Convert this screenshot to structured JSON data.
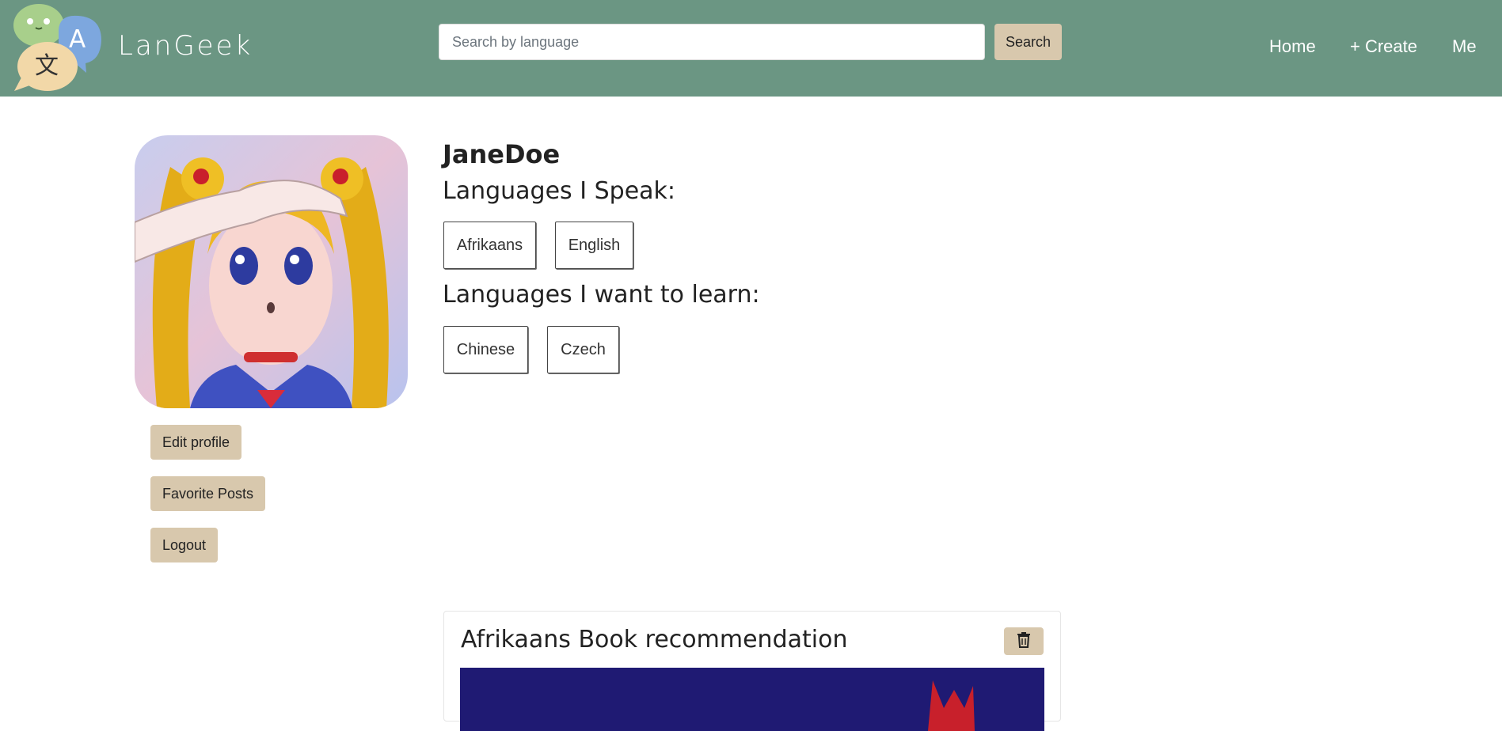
{
  "brand": {
    "name": "LanGeek"
  },
  "search": {
    "placeholder": "Search by language",
    "button_label": "Search"
  },
  "nav": {
    "home": "Home",
    "create": "+ Create",
    "me": "Me"
  },
  "profile": {
    "username": "JaneDoe",
    "speak_heading": "Languages I Speak:",
    "speak_languages": [
      "Afrikaans",
      "English"
    ],
    "learn_heading": "Languages I want to learn:",
    "learn_languages": [
      "Chinese",
      "Czech"
    ]
  },
  "actions": {
    "edit_profile": "Edit profile",
    "favorite_posts": "Favorite Posts",
    "logout": "Logout"
  },
  "posts": [
    {
      "title": "Afrikaans Book recommendation"
    }
  ],
  "colors": {
    "navbar": "#6b9683",
    "button_beige": "#d8c8ad",
    "post_image_bg": "#1f1a73"
  }
}
